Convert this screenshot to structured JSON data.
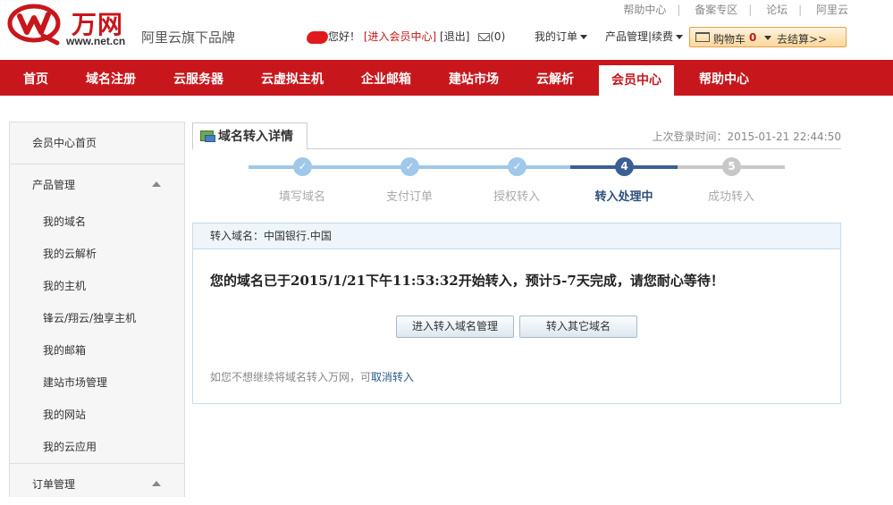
{
  "brand": {
    "name": "万网",
    "domain": "www.net.cn",
    "slogan": "阿里云旗下品牌",
    "accent_color": "#c8171c"
  },
  "top_links": [
    "帮助中心",
    "备案专区",
    "论坛",
    "阿里云"
  ],
  "userbar": {
    "greeting": "您好！",
    "member_center_link": "[进入会员中心]",
    "logout_link": "[退出]",
    "mail_icon": "mail-icon",
    "mail_count": "(0)"
  },
  "menus": {
    "orders": "我的订单",
    "product_management": "产品管理|续费"
  },
  "cart": {
    "label": "购物车",
    "count": "0",
    "checkout": "去结算>>"
  },
  "nav": {
    "items": [
      "首页",
      "域名注册",
      "云服务器",
      "云虚拟主机",
      "企业邮箱",
      "建站市场",
      "云解析",
      "会员中心",
      "帮助中心"
    ],
    "active": "会员中心"
  },
  "sidebar": {
    "home": "会员中心首页",
    "groups": [
      {
        "label": "产品管理",
        "expanded": true,
        "items": [
          "我的域名",
          "我的云解析",
          "我的主机",
          "锋云/翔云/独享主机",
          "我的邮箱",
          "建站市场管理",
          "我的网站",
          "我的云应用"
        ]
      },
      {
        "label": "订单管理",
        "expanded": true,
        "items": []
      }
    ]
  },
  "main": {
    "tab_title": "域名转入详情",
    "last_login": "上次登录时间：2015-01-21 22:44:50",
    "steps": [
      {
        "label": "填写域名",
        "status": "done",
        "mark": "✓"
      },
      {
        "label": "支付订单",
        "status": "done",
        "mark": "✓"
      },
      {
        "label": "授权转入",
        "status": "done",
        "mark": "✓"
      },
      {
        "label": "转入处理中",
        "status": "current",
        "mark": "4"
      },
      {
        "label": "成功转入",
        "status": "pending",
        "mark": "5"
      }
    ],
    "colors": {
      "done": "#9fc8ea",
      "current": "#3b5f93",
      "pending": "#c8c8c8"
    },
    "panel": {
      "domain_line": "转入域名：中国银行.中国",
      "message": "您的域名已于2015/1/21下午11:53:32开始转入，预计5-7天完成，请您耐心等待！",
      "buttons": [
        "进入转入域名管理",
        "转入其它域名"
      ],
      "note_prefix": "如您不想继续将域名转入万网，可",
      "note_link": "取消转入"
    }
  }
}
